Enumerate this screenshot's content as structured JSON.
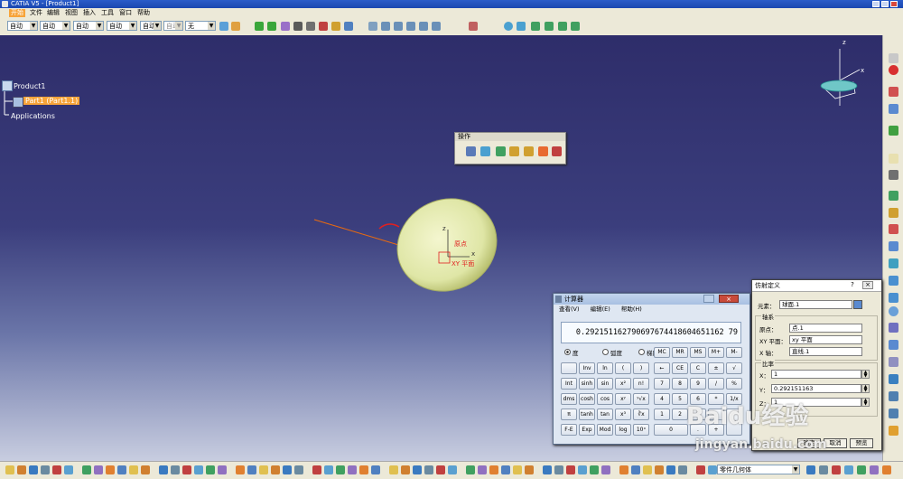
{
  "window": {
    "title": "CATIA V5 - [Product1]"
  },
  "menu": [
    "开始",
    "文件",
    "编辑",
    "视图",
    "插入",
    "工具",
    "窗口",
    "帮助"
  ],
  "toolbar": {
    "combos": [
      "自动",
      "自动",
      "自动",
      "自动",
      "自动",
      "自动",
      "无"
    ]
  },
  "tree": {
    "root": "Product1",
    "part": "Part1 (Part1.1)",
    "applications": "Applications"
  },
  "viewport": {
    "sphere_label_origin": "原点",
    "sphere_label_plane": "XY 平面",
    "sphere_label_x": "x",
    "sphere_label_z": "z",
    "compass_x": "x",
    "compass_z": "z"
  },
  "op_toolbar": {
    "title": "操作"
  },
  "calculator": {
    "title": "计算器",
    "menu": [
      "查看(V)",
      "编辑(E)",
      "帮助(H)"
    ],
    "display": "0.292151162790697674418604651162 79",
    "angle_modes": [
      "度",
      "弧度",
      "梯度"
    ],
    "memory_buttons": [
      "MC",
      "MR",
      "MS",
      "M+",
      "M-"
    ],
    "rows": [
      [
        "",
        "Inv",
        "ln",
        "(",
        ")",
        "←",
        "CE",
        "C",
        "±",
        "√"
      ],
      [
        "Int",
        "sinh",
        "sin",
        "x²",
        "n!",
        "7",
        "8",
        "9",
        "/",
        "%"
      ],
      [
        "dms",
        "cosh",
        "cos",
        "xʸ",
        "ʸ√x",
        "4",
        "5",
        "6",
        "*",
        "1/x"
      ],
      [
        "π",
        "tanh",
        "tan",
        "x³",
        "∛x",
        "1",
        "2",
        "3",
        "-",
        "="
      ],
      [
        "F-E",
        "Exp",
        "Mod",
        "log",
        "10ˣ",
        "0",
        ".",
        "+"
      ]
    ]
  },
  "affine": {
    "title": "仿射定义",
    "element_label": "元素：",
    "element_value": "球面.1",
    "axis_group": "轴系",
    "origin_label": "原点：",
    "origin_value": "点.1",
    "plane_label": "XY 平面：",
    "plane_value": "xy 平面",
    "xaxis_label": "X 轴：",
    "xaxis_value": "直线.1",
    "ratio_group": "比率",
    "x_label": "X：",
    "x_value": "1",
    "y_label": "Y：",
    "y_value": "0.292151163",
    "z_label": "Z：",
    "z_value": "1",
    "ok_label": "确定",
    "cancel_label": "取消",
    "preview_label": "预览"
  },
  "bottom": {
    "body_combo": "零件几何体"
  },
  "watermark": {
    "logo": "Baidu经验",
    "url": "jingyan.baidu.com"
  },
  "colors": {
    "accent": "#f7a43a",
    "viewport_top": "#2e2d6a",
    "sphere": "#e8ecb8"
  }
}
